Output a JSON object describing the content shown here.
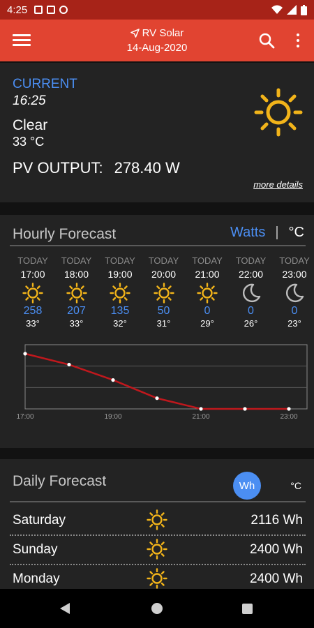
{
  "status_bar": {
    "time": "4:25"
  },
  "app_bar": {
    "title": "RV Solar",
    "date": "14-Aug-2020"
  },
  "current": {
    "label": "CURRENT",
    "time": "16:25",
    "condition": "Clear",
    "temperature": "33 °C",
    "pv_label": "PV OUTPUT:",
    "pv_value": "278.40 W",
    "more_details": "more details",
    "icon": "sun-icon"
  },
  "hourly": {
    "title": "Hourly Forecast",
    "toggle_watts": "Watts",
    "toggle_sep": "|",
    "toggle_celsius": "°C",
    "items": [
      {
        "day": "TODAY",
        "time": "17:00",
        "icon": "sun-icon",
        "watts": "258",
        "temp": "33°"
      },
      {
        "day": "TODAY",
        "time": "18:00",
        "icon": "sun-icon",
        "watts": "207",
        "temp": "33°"
      },
      {
        "day": "TODAY",
        "time": "19:00",
        "icon": "sun-icon",
        "watts": "135",
        "temp": "32°"
      },
      {
        "day": "TODAY",
        "time": "20:00",
        "icon": "sun-icon",
        "watts": "50",
        "temp": "31°"
      },
      {
        "day": "TODAY",
        "time": "21:00",
        "icon": "sun-icon",
        "watts": "0",
        "temp": "29°"
      },
      {
        "day": "TODAY",
        "time": "22:00",
        "icon": "moon-icon",
        "watts": "0",
        "temp": "26°"
      },
      {
        "day": "TODAY",
        "time": "23:00",
        "icon": "moon-icon",
        "watts": "0",
        "temp": "23°"
      }
    ]
  },
  "chart_data": {
    "type": "line",
    "x": [
      "17:00",
      "18:00",
      "19:00",
      "20:00",
      "21:00",
      "22:00",
      "23:00"
    ],
    "x_tick_labels": [
      "17:00",
      "19:00",
      "21:00",
      "23:00"
    ],
    "series": [
      {
        "values": [
          258,
          207,
          135,
          50,
          0,
          0,
          0
        ],
        "color": "#c0181d"
      }
    ],
    "ylim": [
      0,
      300
    ],
    "grid": true
  },
  "daily": {
    "title": "Daily Forecast",
    "wh_label": "Wh",
    "c_label": "°C",
    "rows": [
      {
        "day": "Saturday",
        "icon": "sun-icon",
        "value": "2116 Wh"
      },
      {
        "day": "Sunday",
        "icon": "sun-icon",
        "value": "2400 Wh"
      },
      {
        "day": "Monday",
        "icon": "sun-icon",
        "value": "2400 Wh"
      }
    ]
  },
  "colors": {
    "accent": "#4b8ef2",
    "appbar": "#e14431",
    "statusbar": "#a72318",
    "sun": "#f2b41a",
    "chart_line": "#c0181d"
  }
}
